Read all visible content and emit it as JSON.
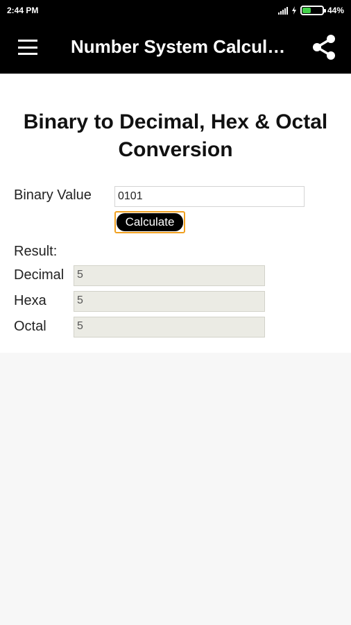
{
  "status_bar": {
    "time": "2:44 PM",
    "battery_percent": "44%",
    "battery_level": 0.44
  },
  "app_bar": {
    "title": "Number System Calcul…"
  },
  "page": {
    "title": "Binary to Decimal, Hex & Octal Conversion"
  },
  "form": {
    "binary_label": "Binary Value",
    "binary_value": "0101",
    "calculate_label": "Calculate",
    "result_label": "Result:",
    "results": [
      {
        "label": "Decimal",
        "value": "5"
      },
      {
        "label": "Hexa",
        "value": "5"
      },
      {
        "label": "Octal",
        "value": "5"
      }
    ]
  },
  "colors": {
    "accent": "#f0a020",
    "battery": "#43d14a",
    "app_bar": "#000000"
  },
  "icons": [
    "signal-icon",
    "charging-bolt-icon",
    "battery-icon",
    "menu-icon",
    "share-icon"
  ]
}
